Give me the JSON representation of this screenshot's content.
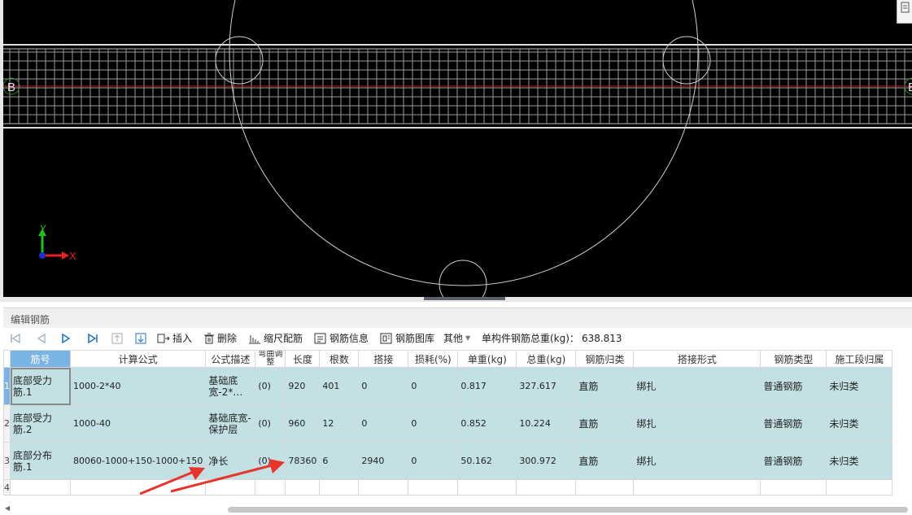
{
  "canvas": {
    "axis_x_label": "X",
    "axis_y_label": "Y",
    "axis_marker_left": "B",
    "axis_marker_right": "B"
  },
  "panel": {
    "title": "编辑钢筋"
  },
  "toolbar": {
    "insert": "插入",
    "delete": "删除",
    "scale_rebar": "缩尺配筋",
    "rebar_info": "钢筋信息",
    "rebar_library": "钢筋图库",
    "other": "其他",
    "total_weight_label": "单构件钢筋总重(kg)：",
    "total_weight_value": "638.813"
  },
  "table": {
    "headers": [
      "筋号",
      "计算公式",
      "公式描述",
      "弯曲调整",
      "长度",
      "根数",
      "搭接",
      "损耗(%)",
      "单重(kg)",
      "总重(kg)",
      "钢筋归类",
      "搭接形式",
      "钢筋类型",
      "施工段归属"
    ],
    "rows": [
      {
        "num": "1",
        "name": "底部受力筋.1",
        "formula": "1000-2*40",
        "desc": "基础底宽-2*…",
        "bend": "(0)",
        "length": "920",
        "count": "401",
        "lap": "0",
        "loss": "0",
        "unit_weight": "0.817",
        "total_weight": "327.617",
        "category": "直筋",
        "lap_type": "绑扎",
        "rebar_type": "普通钢筋",
        "section": "未归类"
      },
      {
        "num": "2",
        "name": "底部受力筋.2",
        "formula": "1000-40",
        "desc": "基础底宽-保护层",
        "bend": "(0)",
        "length": "960",
        "count": "12",
        "lap": "0",
        "loss": "0",
        "unit_weight": "0.852",
        "total_weight": "10.224",
        "category": "直筋",
        "lap_type": "绑扎",
        "rebar_type": "普通钢筋",
        "section": "未归类"
      },
      {
        "num": "3",
        "name": "底部分布筋.1",
        "formula": "80060-1000+150-1000+150",
        "desc": "净长",
        "bend": "(0)",
        "length": "78360",
        "count": "6",
        "lap": "2940",
        "loss": "0",
        "unit_weight": "50.162",
        "total_weight": "300.972",
        "category": "直筋",
        "lap_type": "绑扎",
        "rebar_type": "普通钢筋",
        "section": "未归类"
      }
    ],
    "empty_row_num": "4"
  },
  "colors": {
    "accent": "#7ab3e6",
    "row_bg": "#c3e0e4",
    "annotation": "#e8342a"
  }
}
